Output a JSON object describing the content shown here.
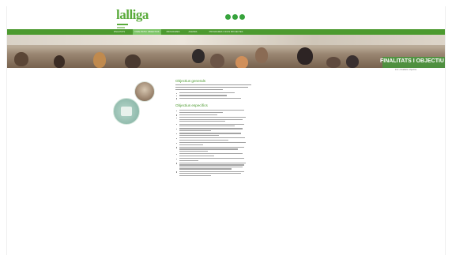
{
  "brand": {
    "logo_text": "lalliga",
    "accent": "#4c9a2f",
    "accent_light": "#7cc467"
  },
  "social": [
    "facebook-icon",
    "twitter-icon",
    "youtube-icon"
  ],
  "nav": {
    "items": [
      {
        "label": "FINALITATS"
      },
      {
        "label": "FINALITATS I OBJECTIUS",
        "active": true
      },
      {
        "label": "PROGRAMES"
      },
      {
        "label": "AGENDA"
      },
      {
        "label": "PROGRAMES I NOUS PROJECTES"
      }
    ]
  },
  "banner": {
    "title": "FINALITATS I OBJECTIU"
  },
  "breadcrumb": "Inici › Finalitats i objectius",
  "content": {
    "general_title": "Objectius generals",
    "specific_title": "Objectius específics"
  }
}
